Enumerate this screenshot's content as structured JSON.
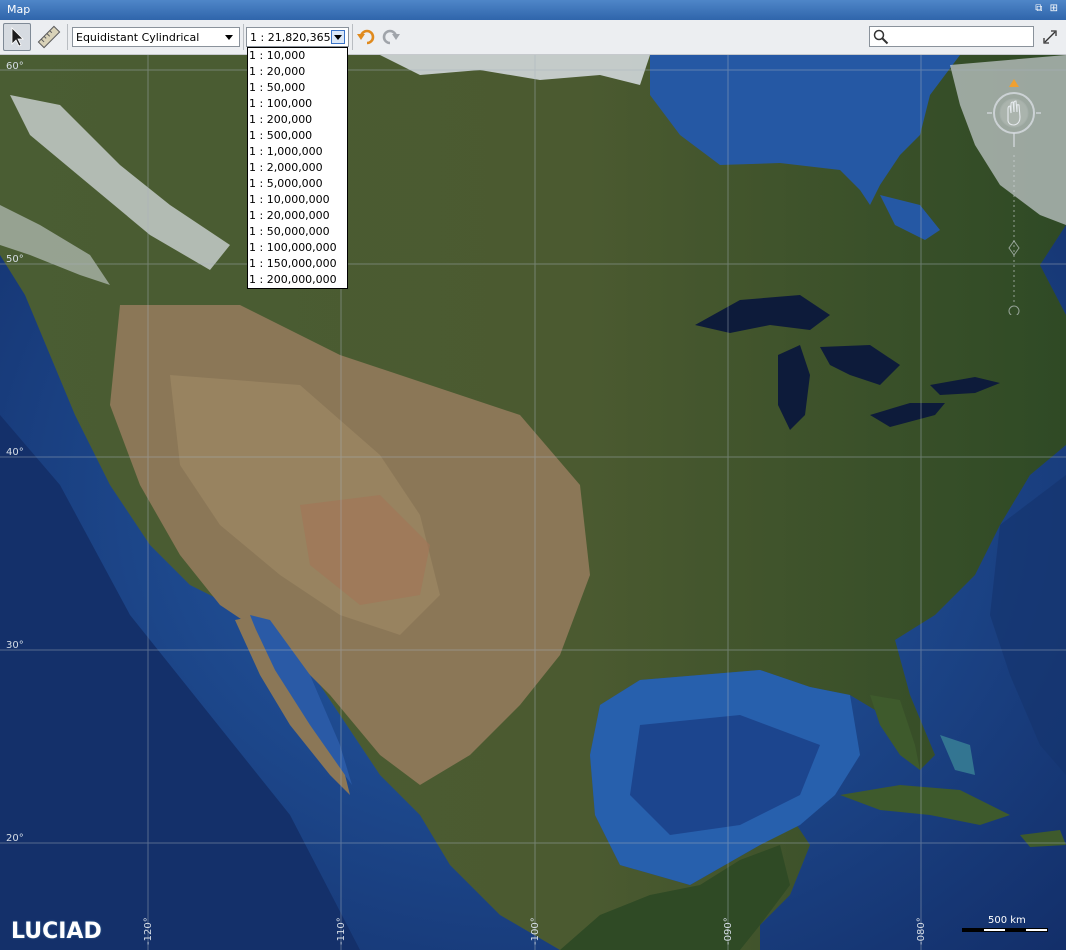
{
  "window": {
    "title": "Map",
    "controls": "⧉ ⊞"
  },
  "toolbar": {
    "projection": "Equidistant Cylindrical",
    "scale": "1 : 21,820,365",
    "search_placeholder": ""
  },
  "scale_options": [
    "1 : 10,000",
    "1 : 20,000",
    "1 : 50,000",
    "1 : 100,000",
    "1 : 200,000",
    "1 : 500,000",
    "1 : 1,000,000",
    "1 : 2,000,000",
    "1 : 5,000,000",
    "1 : 10,000,000",
    "1 : 20,000,000",
    "1 : 50,000,000",
    "1 : 100,000,000",
    "1 : 150,000,000",
    "1 : 200,000,000"
  ],
  "map": {
    "lat_labels": {
      "l60": "60°",
      "l50": "50°",
      "l40": "40°",
      "l30": "30°",
      "l20": "20°"
    },
    "lon_labels": {
      "w120": "-120°",
      "w110": "-110°",
      "w100": "-100°",
      "w90": "-090°",
      "w80": "-080°"
    },
    "scale_bar": "500 km",
    "logo": "LUCIAD",
    "colors": {
      "ocean": "#1f4f97",
      "deep_ocean": "#14336f",
      "land": "#3d5a2c",
      "desert": "#8a7554",
      "ice": "#e6ebef"
    }
  }
}
